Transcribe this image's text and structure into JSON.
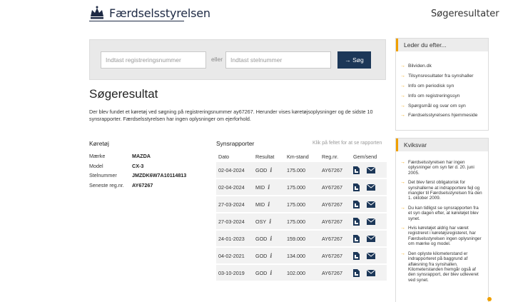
{
  "header": {
    "brand": "Færdselsstyrelsen",
    "page_title": "Søgeresultater"
  },
  "search": {
    "reg_placeholder": "Indtast registreringsnummer",
    "or_label": "eller",
    "stel_placeholder": "Indtast stelnummer",
    "button_label": "→ Søg"
  },
  "result": {
    "title": "Søgeresultat",
    "description": "Der blev fundet et køretøj ved søgning på registreringsnummer ay67267. Herunder vises køretøjsoplysninger og de sidste 10 synsrapporter. Færdselsstyrelsen har ingen oplysninger om ejerforhold."
  },
  "vehicle": {
    "heading": "Køretøj",
    "rows": [
      {
        "label": "Mærke",
        "value": "MAZDA"
      },
      {
        "label": "Model",
        "value": "CX-3"
      },
      {
        "label": "Stelnummer",
        "value": "JMZDK6W7A10114813"
      },
      {
        "label": "Seneste reg.nr.",
        "value": "AY67267"
      }
    ]
  },
  "reports": {
    "heading": "Synsrapporter",
    "hint": "Klik på feltet for at se rapporten",
    "columns": [
      "Dato",
      "Resultat",
      "Km-stand",
      "Reg.nr.",
      "Gem/send"
    ],
    "rows": [
      {
        "date": "02-04-2024",
        "result": "GOD",
        "km": "175.000",
        "reg": "AY67267"
      },
      {
        "date": "02-04-2024",
        "result": "MID",
        "km": "175.000",
        "reg": "AY67267"
      },
      {
        "date": "27-03-2024",
        "result": "MID",
        "km": "175.000",
        "reg": "AY67267"
      },
      {
        "date": "27-03-2024",
        "result": "OSY",
        "km": "175.000",
        "reg": "AY67267"
      },
      {
        "date": "24-01-2023",
        "result": "GOD",
        "km": "159.000",
        "reg": "AY67267"
      },
      {
        "date": "04-02-2021",
        "result": "GOD",
        "km": "134.000",
        "reg": "AY67267"
      },
      {
        "date": "03-10-2019",
        "result": "GOD",
        "km": "102.000",
        "reg": "AY67267"
      }
    ]
  },
  "sidebar": {
    "links_heading": "Leder du efter...",
    "links": [
      "Bilviden.dk",
      "Tilsynsresultater fra synshaller",
      "Info om periodisk syn",
      "Info om registreringssyn",
      "Spørgsmål og svar om syn",
      "Færdselsstyrelsens hjemmeside"
    ],
    "kvik_heading": "Kviksvar",
    "kvik_items": [
      "Færdselsstyrelsen har ingen oplysninger om syn før d. 20. juni 2005.",
      "Det blev først obligatorisk for synshallerne at indrapportere fejl og mangler til Færdselsstyrelsen fra den 1. oktober 2009.",
      "Du kan tidligst se synsrapporten fra et syn dagen efter, at køretøjet blev synet.",
      "Hvis køretøjet aldrig har været registreret i køretøjsregisteret, har Færdselsstyrelsen ingen oplysninger om mærke og model.",
      "Den oplyste kilometerstand er indrapporteret på baggrund af aflæsning fra synshallen. Kilometerstanden fremgår også af den synsrapport, der blev udleveret ved synet."
    ]
  },
  "colors": {
    "accent": "#f0a000",
    "button": "#1c3758",
    "brand": "#1e2a44"
  }
}
